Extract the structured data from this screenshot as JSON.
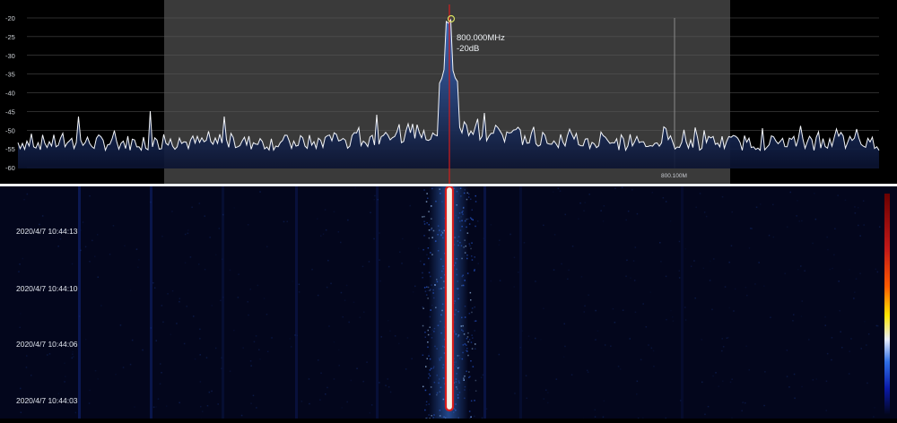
{
  "spectrum": {
    "y_axis": {
      "ticks": [
        "-20",
        "-25",
        "-30",
        "-35",
        "-40",
        "-45",
        "-50",
        "-55",
        "-60"
      ],
      "range_db": [
        -60,
        -20
      ]
    },
    "marker": {
      "frequency": "800.000MHz",
      "level": "-20dB"
    },
    "frequency_label": "800.100M",
    "colors": {
      "background": "#000000",
      "span_highlight": "#3a3a3a",
      "trace": "#f4f6fa",
      "fill_top": "#3f6fc4",
      "fill_bottom": "#0a1230",
      "center_line": "#d21c1c",
      "marker_ring": "#d8e060"
    }
  },
  "waterfall": {
    "timestamps": [
      "2020/4/7 10:44:13",
      "2020/4/7 10:44:10",
      "2020/4/7 10:44:06",
      "2020/4/7 10:44:03"
    ],
    "colors": {
      "background": "#03061c",
      "signal_core": "#f6f1e6",
      "signal_edge": "#d81c1c",
      "noise": "#3d7ee6",
      "colorbar": [
        "#6a0000",
        "#c21818",
        "#ff5a00",
        "#ffe600",
        "#e8eeff",
        "#2f6fe6",
        "#0a1aa8",
        "#03061c"
      ]
    }
  }
}
